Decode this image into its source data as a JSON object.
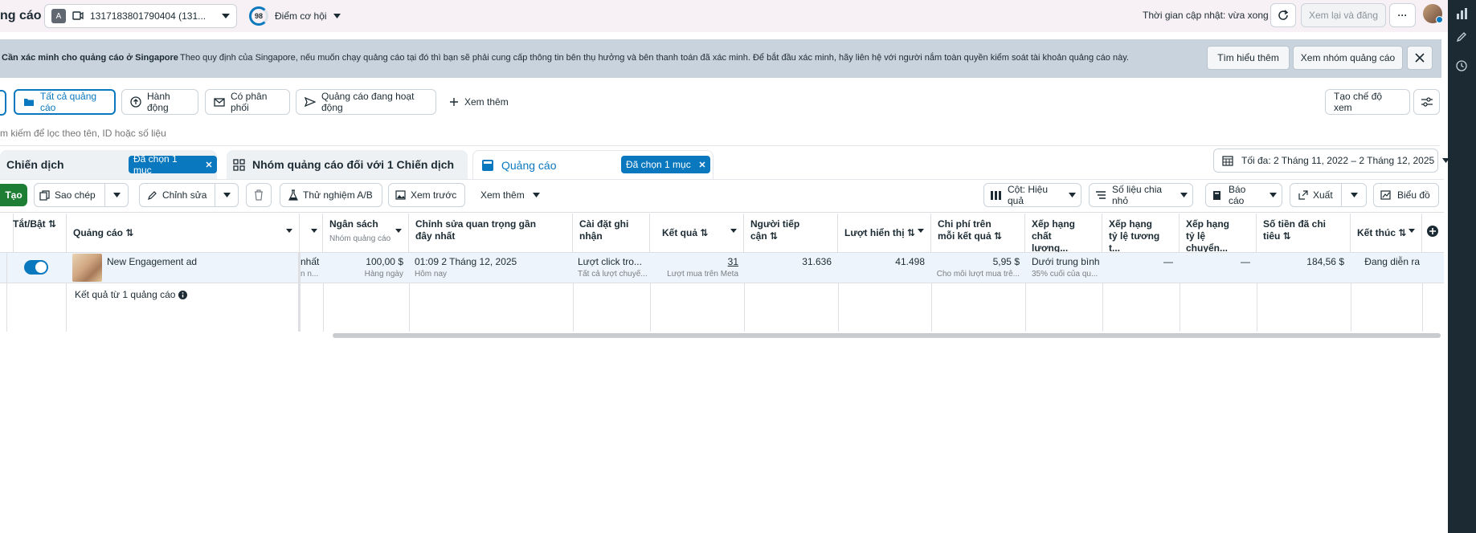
{
  "header": {
    "title": "ng cáo",
    "account_initial": "A",
    "account_id": "1317183801790404 (131...",
    "opportunity_score": "98",
    "opportunity_label": "Điểm cơ hội",
    "updated": "Thời gian cập nhật: vừa xong",
    "review_publish": "Xem lại và đăng",
    "more": "···"
  },
  "banner": {
    "title": "Cần xác minh cho quảng cáo ở Singapore",
    "text": "Theo quy định của Singapore, nếu muốn chạy quảng cáo tại đó thì bạn sẽ phải cung cấp thông tin bên thụ hưởng và bên thanh toán đã xác minh. Để bắt đầu xác minh, hãy liên hệ với người nắm toàn quyền kiểm soát tài khoản quảng cáo này.",
    "learn_more": "Tìm hiểu thêm",
    "view_adsets": "Xem nhóm quảng cáo"
  },
  "filters": {
    "chips": [
      "Tất cả quảng cáo",
      "Hành động",
      "Có phân phối",
      "Quảng cáo đang hoạt động"
    ],
    "see_more": "Xem thêm",
    "create_view": "Tạo chế độ xem"
  },
  "search": {
    "placeholder": "m kiếm để lọc theo tên, ID hoặc số liệu"
  },
  "tabs": {
    "campaigns": "Chiến dịch",
    "adsets": "Nhóm quảng cáo đối với 1 Chiến dịch",
    "ads": "Quảng cáo",
    "selected": "Đã chọn 1 mục",
    "date_range": "Tối đa: 2 Tháng 11, 2022 – 2 Tháng 12, 2025"
  },
  "toolbar": {
    "create": "Tạo",
    "duplicate": "Sao chép",
    "edit": "Chỉnh sửa",
    "ab_test": "Thử nghiệm A/B",
    "preview": "Xem trước",
    "see_more": "Xem thêm",
    "columns": "Cột: Hiệu quả",
    "breakdown": "Số liệu chia nhỏ",
    "reports": "Báo cáo",
    "export": "Xuất",
    "charts": "Biểu đồ"
  },
  "table": {
    "headers": {
      "toggle": "Tắt/Bật ⇅",
      "ad": "Quảng cáo ⇅",
      "budget": "Ngân sách",
      "budget_sub": "Nhóm quảng cáo",
      "last_edit": "Chỉnh sửa quan trọng gần đây nhất",
      "attribution": "Cài đặt ghi nhận",
      "results": "Kết quả ⇅",
      "reach": "Người tiếp cận ⇅",
      "impressions": "Lượt hiển thị ⇅",
      "cpr": "Chi phí trên mỗi kết quả ⇅",
      "quality": "Xếp hạng chất lượng...",
      "engagement": "Xếp hạng tỷ lệ tương t...",
      "conversion": "Xếp hạng tỷ lệ chuyển...",
      "spent": "Số tiền đã chi tiêu ⇅",
      "end": "Kết thúc ⇅"
    },
    "row": {
      "ad_name": "New Engagement ad",
      "partial_top": "nhất",
      "partial_sub": "n n...",
      "budget": "100,00 $",
      "budget_sub": "Hàng ngày",
      "last_edit": "01:09 2 Tháng 12, 2025",
      "last_edit_sub": "Hôm nay",
      "attribution": "Lượt click tro...",
      "attribution_sub": "Tất cả lượt chuyể...",
      "results": "31",
      "results_sub": "Lượt mua trên Meta",
      "reach": "31.636",
      "impressions": "41.498",
      "cpr": "5,95 $",
      "cpr_sub": "Cho mỗi lượt mua trê...",
      "quality": "Dưới trung bình",
      "quality_sub": "35% cuối của qu...",
      "engagement": "—",
      "conversion": "—",
      "spent": "184,56 $",
      "end": "Đang diễn ra"
    },
    "summary": "Kết quả từ 1 quảng cáo"
  },
  "colors": {
    "accent": "#0a78be",
    "create": "#1e7e34",
    "rail": "#1c2b33",
    "banner": "#c9d3dd"
  }
}
